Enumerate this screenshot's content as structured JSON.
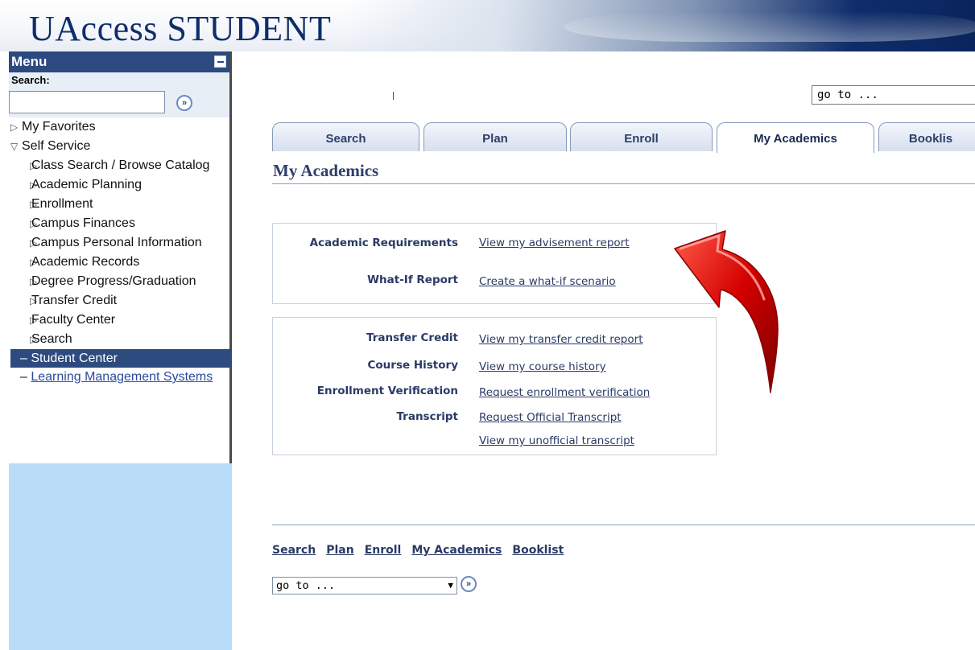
{
  "banner": {
    "title_u": "U",
    "title_access": "Access ",
    "title_student": "STUDENT"
  },
  "menu": {
    "title": "Menu",
    "search_label": "Search:",
    "go_glyph": "»",
    "items": [
      {
        "label": "My Favorites",
        "kind": "collapsed"
      },
      {
        "label": "Self Service",
        "kind": "expanded"
      },
      {
        "label": "Class Search / Browse Catalog",
        "kind": "sub"
      },
      {
        "label": "Academic Planning",
        "kind": "sub"
      },
      {
        "label": "Enrollment",
        "kind": "sub"
      },
      {
        "label": "Campus Finances",
        "kind": "sub"
      },
      {
        "label": "Campus Personal Information",
        "kind": "sub"
      },
      {
        "label": "Academic Records",
        "kind": "sub"
      },
      {
        "label": "Degree Progress/Graduation",
        "kind": "sub"
      },
      {
        "label": "Transfer Credit",
        "kind": "sub"
      },
      {
        "label": "Faculty Center",
        "kind": "sub"
      },
      {
        "label": "Search",
        "kind": "sub"
      },
      {
        "label": "Student Center",
        "kind": "active"
      },
      {
        "label": "Learning Management Systems",
        "kind": "link"
      }
    ]
  },
  "main": {
    "goto_top": "go to ...",
    "tabs": [
      "Search",
      "Plan",
      "Enroll",
      "My Academics",
      "Booklis"
    ],
    "active_tab": "My Academics",
    "page_title": "My Academics",
    "box1": [
      {
        "label": "Academic Requirements",
        "link": "View my advisement report"
      },
      {
        "label": "What-If Report",
        "link": "Create a what-if scenario"
      }
    ],
    "box2": [
      {
        "label": "Transfer Credit",
        "link": "View my transfer credit report"
      },
      {
        "label": "Course History",
        "link": "View my course history"
      },
      {
        "label": "Enrollment Verification",
        "link": "Request enrollment verification"
      },
      {
        "label": "Transcript",
        "link": "Request Official Transcript"
      },
      {
        "label": "",
        "link": "View my unofficial transcript"
      }
    ],
    "bottom_links": [
      "Search",
      "Plan",
      "Enroll",
      "My Academics",
      "Booklist"
    ],
    "goto_bottom": "go to ..."
  },
  "colors": {
    "menu_header": "#2c4a7f",
    "active_item": "#2d4b7f",
    "sidebar_fill": "#b9dcf9",
    "arrow": "#d40000"
  }
}
